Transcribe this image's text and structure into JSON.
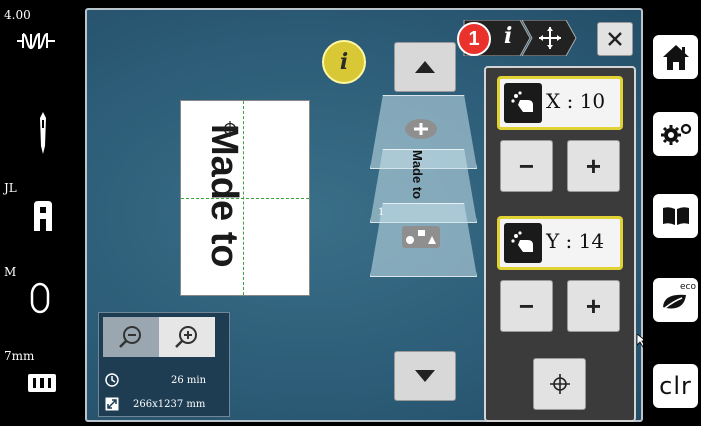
{
  "left_bar": {
    "speed": "4.00",
    "presser_foot_label": "JL",
    "hoop_label": "M",
    "needle_size": "7mm",
    "icons": [
      "stitch-regulator-icon",
      "needle-icon",
      "presser-foot-icon",
      "hoop-icon",
      "needle-plate-icon"
    ]
  },
  "right_bar": {
    "home_icon": "home-icon",
    "settings_icon": "settings-icon",
    "guide_icon": "book-icon",
    "eco_label": "eco",
    "clr_label": "clr"
  },
  "canvas": {
    "design_text": "Made to"
  },
  "layers": {
    "layer_text": "Made to",
    "layer_number": "1",
    "icons": [
      "add-layer-icon",
      "layer-settings-icon"
    ]
  },
  "zoom": {
    "time": "26 min",
    "size": "266x1237 mm"
  },
  "tabs": {
    "badge_number": "1",
    "info_tab": "i",
    "move_tab": "move-icon",
    "close": "close-icon"
  },
  "panel": {
    "x_label": "X : 10",
    "y_label": "Y : 14",
    "minus": "−",
    "plus": "+",
    "center_icon": "center-crosshair-icon"
  },
  "colors": {
    "accent_yellow": "#e0d235",
    "badge_red": "#e8322b",
    "background_blue": "#2c5c77"
  }
}
